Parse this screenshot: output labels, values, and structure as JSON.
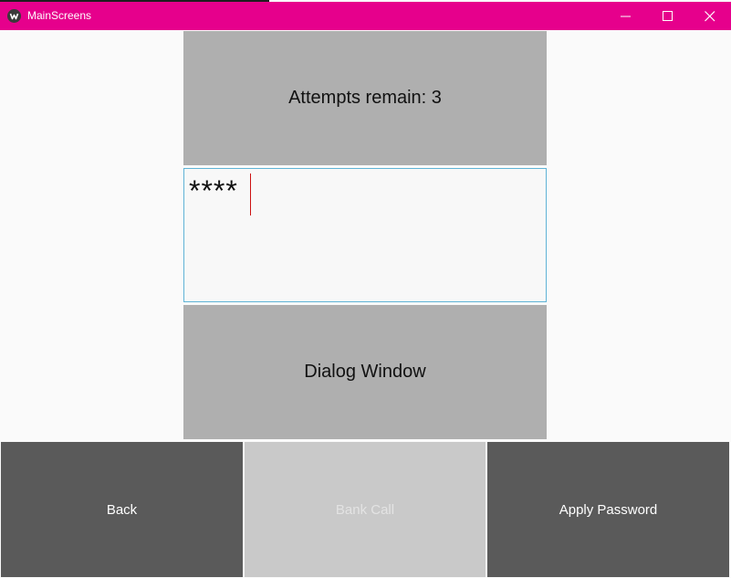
{
  "window": {
    "title": "MainScreens",
    "accent_color": "#e6008c",
    "controls": {
      "minimize_icon": "minimize-icon",
      "maximize_icon": "maximize-icon",
      "close_icon": "close-icon"
    }
  },
  "main": {
    "attempts_label": "Attempts remain: 3",
    "password": {
      "value": "****"
    },
    "dialog_button_label": "Dialog Window"
  },
  "footer": {
    "back_label": "Back",
    "bank_call_label": "Bank Call",
    "bank_call_state": "disabled",
    "apply_label": "Apply Password"
  }
}
